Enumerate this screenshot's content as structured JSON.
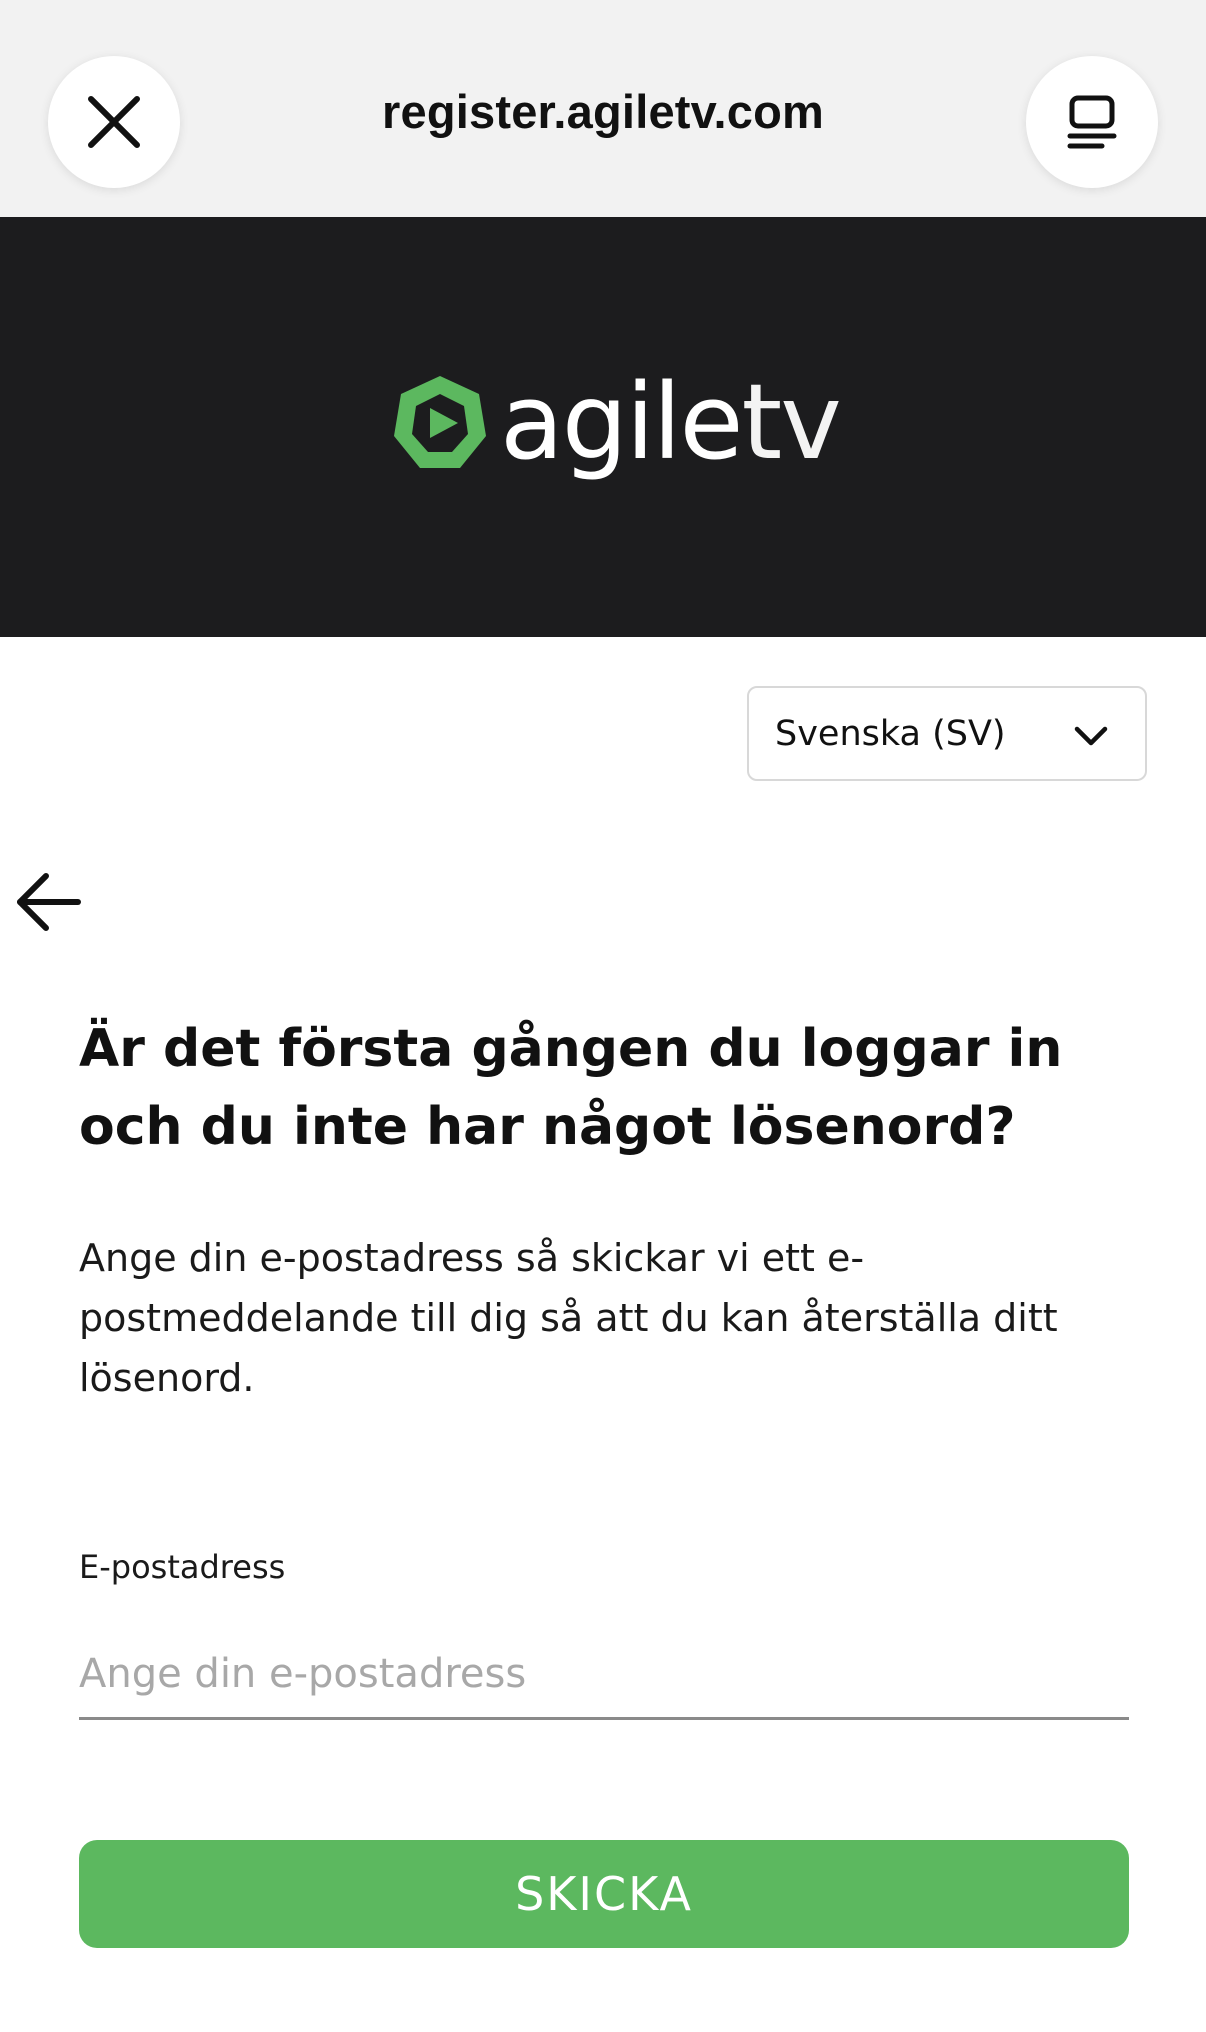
{
  "browser": {
    "url": "register.agiletv.com",
    "close_icon": "close-icon",
    "reader_icon": "reader-mode-icon"
  },
  "brand": {
    "name_part1": "agile",
    "name_part2": "tv",
    "accent": "#5cb85f",
    "background": "#1c1c1e"
  },
  "language": {
    "selected": "Svenska (SV)"
  },
  "main": {
    "heading": "Är det första gången du loggar in och du inte har något lösenord?",
    "description": "Ange din e-postadress så skickar vi ett e-postmeddelande till dig så att du kan återställa ditt lösenord.",
    "email_label": "E-postadress",
    "email_placeholder": "Ange din e-postadress",
    "email_value": "",
    "submit_label": "SKICKA"
  }
}
